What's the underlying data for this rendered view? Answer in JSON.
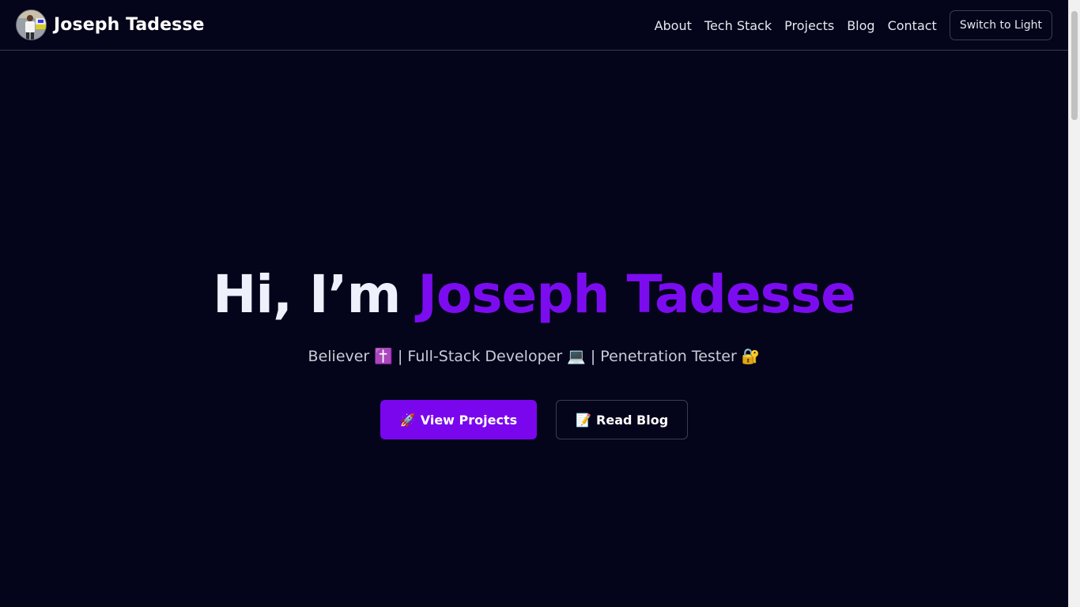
{
  "header": {
    "brand_name": "Joseph Tadesse",
    "nav": [
      "About",
      "Tech Stack",
      "Projects",
      "Blog",
      "Contact"
    ],
    "theme_toggle_label": "Switch to Light"
  },
  "hero": {
    "greeting": "Hi, I’m",
    "name": "Joseph Tadesse",
    "subtitle": "Believer ✝️ | Full-Stack Developer 💻 | Penetration Tester 🔐",
    "primary_button": {
      "icon": "🚀",
      "label": "View Projects"
    },
    "secondary_button": {
      "icon": "📝",
      "label": "Read Blog"
    }
  },
  "colors": {
    "background": "#04051a",
    "accent": "#7a06ee",
    "text": "#f1f2f8",
    "muted_text": "#c9cbd8",
    "border": "#3c3d52"
  }
}
